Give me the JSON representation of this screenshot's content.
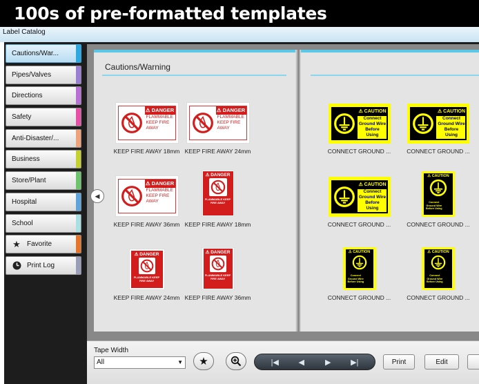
{
  "banner": {
    "title": "100s of pre-formatted templates"
  },
  "app": {
    "title": "Label Catalog"
  },
  "sidebar": {
    "items": [
      {
        "label": "Cautions/War...",
        "color": "#2ea8e0"
      },
      {
        "label": "Pipes/Valves",
        "color": "#9b7fd4"
      },
      {
        "label": "Directions",
        "color": "#b86fd6"
      },
      {
        "label": "Safety",
        "color": "#e74fa8"
      },
      {
        "label": "Anti-Disaster/...",
        "color": "#f0a27a"
      },
      {
        "label": "Business",
        "color": "#c4d12e"
      },
      {
        "label": "Store/Plant",
        "color": "#6cc56c"
      },
      {
        "label": "Hospital",
        "color": "#5fa3dd"
      },
      {
        "label": "School",
        "color": "#a9e0e4"
      },
      {
        "label": "Favorite",
        "color": "#e8742c",
        "icon": "star-icon"
      },
      {
        "label": "Print Log",
        "color": "#9b9eb8",
        "icon": "clock-icon"
      }
    ]
  },
  "main": {
    "section_title": "Cautions/Warning",
    "left_templates": [
      {
        "caption": "KEEP FIRE AWAY 18mm"
      },
      {
        "caption": "KEEP FIRE AWAY 24mm"
      },
      {
        "caption": "KEEP FIRE AWAY 36mm"
      },
      {
        "caption": "KEEP FIRE AWAY 18mm"
      },
      {
        "caption": "KEEP FIRE AWAY 24mm"
      },
      {
        "caption": "KEEP FIRE AWAY 36mm"
      }
    ],
    "right_templates": [
      {
        "caption": "CONNECT GROUND ..."
      },
      {
        "caption": "CONNECT GROUND ..."
      },
      {
        "caption": "CONNECT GROUND ..."
      },
      {
        "caption": "CONNECT GROUND ..."
      },
      {
        "caption": "CONNECT GROUND ..."
      },
      {
        "caption": "CONNECT GROUND ..."
      }
    ],
    "danger_label": {
      "header": "⚠ DANGER",
      "body_lines": [
        "FLAMMABLE",
        "KEEP FIRE",
        "AWAY"
      ],
      "small_text": "FLAMMABLE KEEP FIRE AWAY"
    },
    "caution_label": {
      "header": "⚠ CAUTION",
      "body_lines": [
        "Connect",
        "Ground Wire",
        "Before Using"
      ]
    }
  },
  "bottom": {
    "tape_width_label": "Tape Width",
    "tape_width_value": "All",
    "print_label": "Print",
    "edit_label": "Edit"
  },
  "colors": {
    "accent": "#5bc8e8",
    "danger": "#d31d1d",
    "caution": "#ffff00"
  }
}
